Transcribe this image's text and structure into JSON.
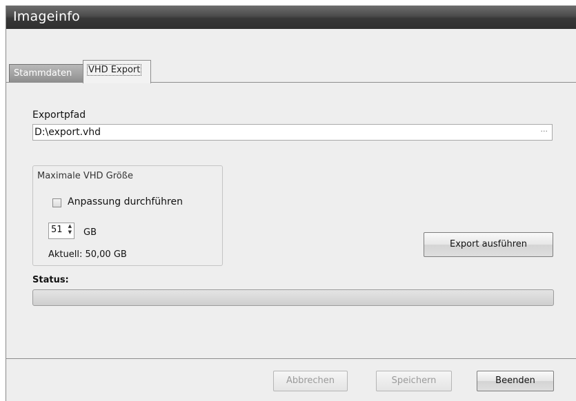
{
  "window": {
    "title": "Imageinfo"
  },
  "tabs": [
    {
      "label": "Stammdaten",
      "active": false
    },
    {
      "label": "VHD Export",
      "active": true
    }
  ],
  "export": {
    "path_label": "Exportpfad",
    "path_value": "D:\\export.vhd",
    "browse_label": "···"
  },
  "size_group": {
    "title": "Maximale VHD Größe",
    "checkbox_label": "Anpassung durchführen",
    "checkbox_checked": false,
    "size_value": "51",
    "unit": "GB",
    "current": "Aktuell: 50,00 GB"
  },
  "export_button": "Export ausführen",
  "status": {
    "label": "Status:",
    "progress": 0
  },
  "footer": {
    "cancel": "Abbrechen",
    "save": "Speichern",
    "close": "Beenden"
  }
}
